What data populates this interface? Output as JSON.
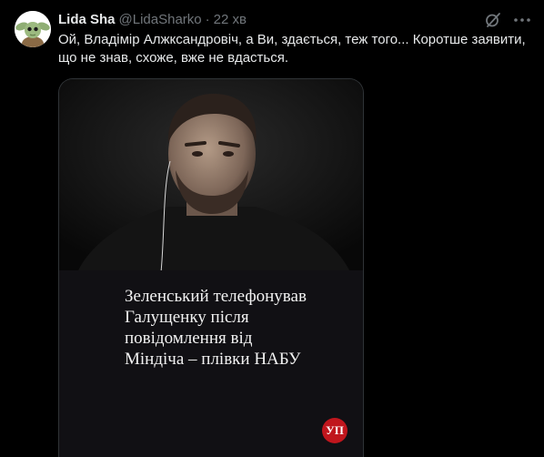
{
  "author": {
    "name": "Lida Sha",
    "handle": "@LidaSharko",
    "separator": "·",
    "time": "22 хв"
  },
  "tweet": {
    "text": "Ой, Владімір Алжксандровіч, а Ви, здається, теж того... Коротше заявити, що не знав, схоже, вже не вдасться."
  },
  "media": {
    "headline_lines": [
      "Зеленський телефонував",
      "Галущенку після",
      "повідомлення від",
      "Міндіча – плівки НАБУ"
    ],
    "logo_text": "УП"
  },
  "icons": {
    "grok": "grok-icon",
    "more": "more-icon"
  }
}
